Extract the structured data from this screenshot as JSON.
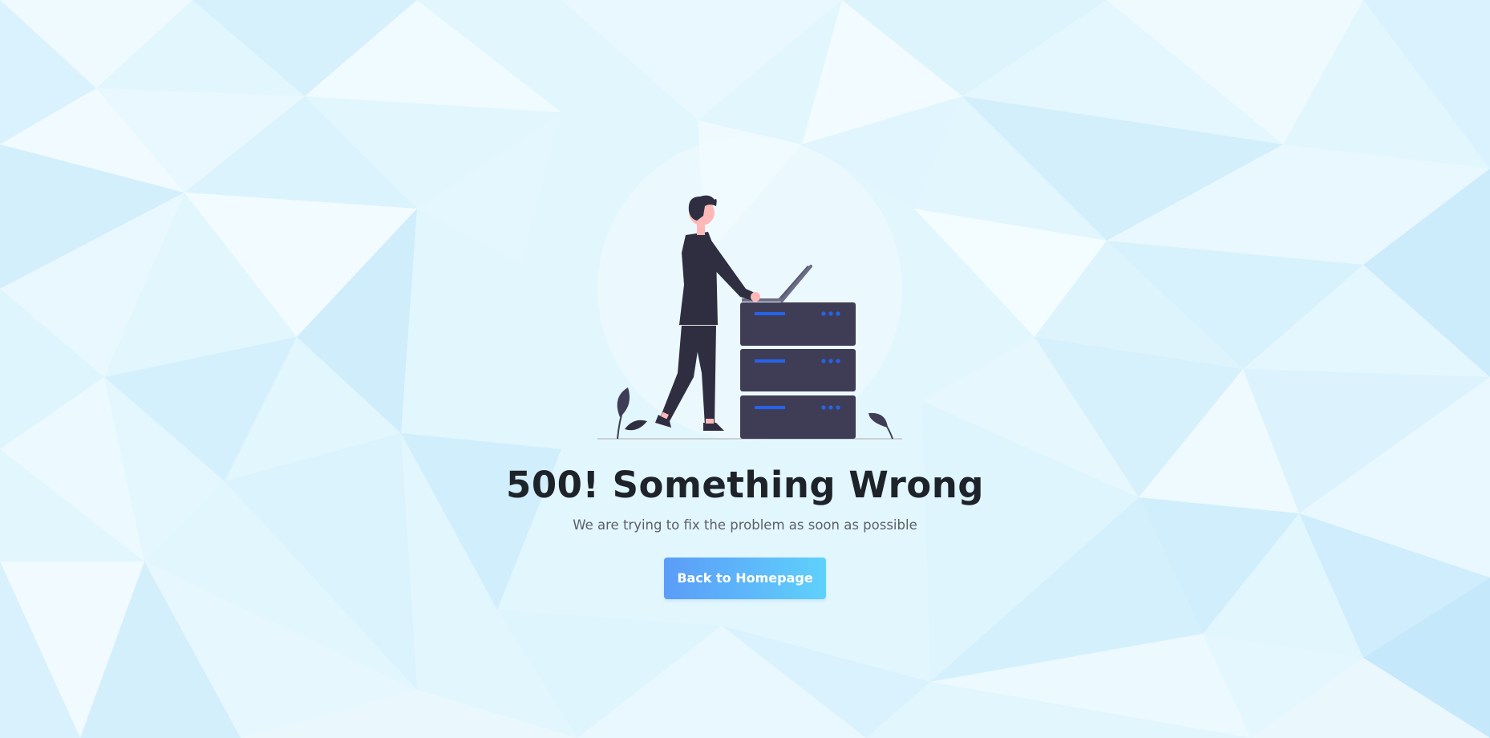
{
  "error": {
    "title": "500! Something Wrong",
    "message": "We are trying to fix the problem as soon as possible"
  },
  "actions": {
    "back_label": "Back to Homepage"
  },
  "illustration": {
    "icon": "person-server-illustration",
    "server_color": "#3f3d56",
    "led_color": "#2563eb"
  },
  "colors": {
    "background": "#dff4fd",
    "button_start": "#5b9cf8",
    "button_end": "#5fd1fb"
  }
}
